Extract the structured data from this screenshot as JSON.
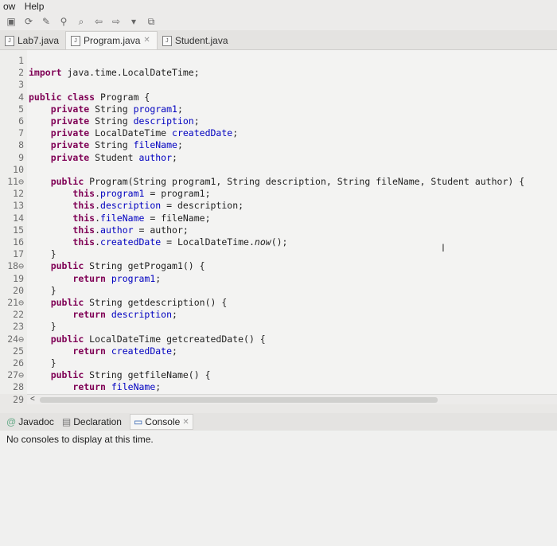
{
  "menubar": {
    "items": [
      "ow",
      "Help"
    ]
  },
  "toolbar": {
    "icons": [
      "save-icon",
      "refresh-icon",
      "edit-icon",
      "annotation-icon",
      "search-icon",
      "back-icon",
      "forward-icon",
      "dropdown-icon",
      "open-task-icon"
    ]
  },
  "tabs": [
    {
      "label": "Lab7.java",
      "active": false
    },
    {
      "label": "Program.java",
      "active": true
    },
    {
      "label": "Student.java",
      "active": false
    }
  ],
  "editor": {
    "lines": [
      {
        "n": "1",
        "code": ""
      },
      {
        "n": "2",
        "code": "import java.time.LocalDateTime;"
      },
      {
        "n": "3",
        "code": ""
      },
      {
        "n": "4",
        "code": "public class Program {"
      },
      {
        "n": "5",
        "code": "    private String program1;"
      },
      {
        "n": "6",
        "code": "    private String description;"
      },
      {
        "n": "7",
        "code": "    private LocalDateTime createdDate;"
      },
      {
        "n": "8",
        "code": "    private String fileName;"
      },
      {
        "n": "9",
        "code": "    private Student author;"
      },
      {
        "n": "10",
        "code": ""
      },
      {
        "n": "11⊖",
        "code": "    public Program(String program1, String description, String fileName, Student author) {"
      },
      {
        "n": "12",
        "code": "        this.program1 = program1;"
      },
      {
        "n": "13",
        "code": "        this.description = description;"
      },
      {
        "n": "14",
        "code": "        this.fileName = fileName;"
      },
      {
        "n": "15",
        "code": "        this.author = author;"
      },
      {
        "n": "16",
        "code": "        this.createdDate = LocalDateTime.now();"
      },
      {
        "n": "17",
        "code": "    }"
      },
      {
        "n": "18⊖",
        "code": "    public String getProgam1() {"
      },
      {
        "n": "19",
        "code": "        return program1;"
      },
      {
        "n": "20",
        "code": "    }"
      },
      {
        "n": "21⊖",
        "code": "    public String getdescription() {"
      },
      {
        "n": "22",
        "code": "        return description;"
      },
      {
        "n": "23",
        "code": "    }"
      },
      {
        "n": "24⊖",
        "code": "    public LocalDateTime getcreatedDate() {"
      },
      {
        "n": "25",
        "code": "        return createdDate;"
      },
      {
        "n": "26",
        "code": "    }"
      },
      {
        "n": "27⊖",
        "code": "    public String getfileName() {"
      },
      {
        "n": "28",
        "code": "        return fileName;"
      },
      {
        "n": "29",
        "code": "    }"
      }
    ]
  },
  "bottom_tabs": [
    {
      "label": "Javadoc",
      "icon": "javadoc-icon",
      "active": false
    },
    {
      "label": "Declaration",
      "icon": "declaration-icon",
      "active": false
    },
    {
      "label": "Console",
      "icon": "console-icon",
      "active": true
    }
  ],
  "console": {
    "message": "No consoles to display at this time."
  },
  "colors": {
    "keyword": "#7f0055",
    "field": "#0000c0",
    "editor_bg": "#f3f3f2"
  }
}
